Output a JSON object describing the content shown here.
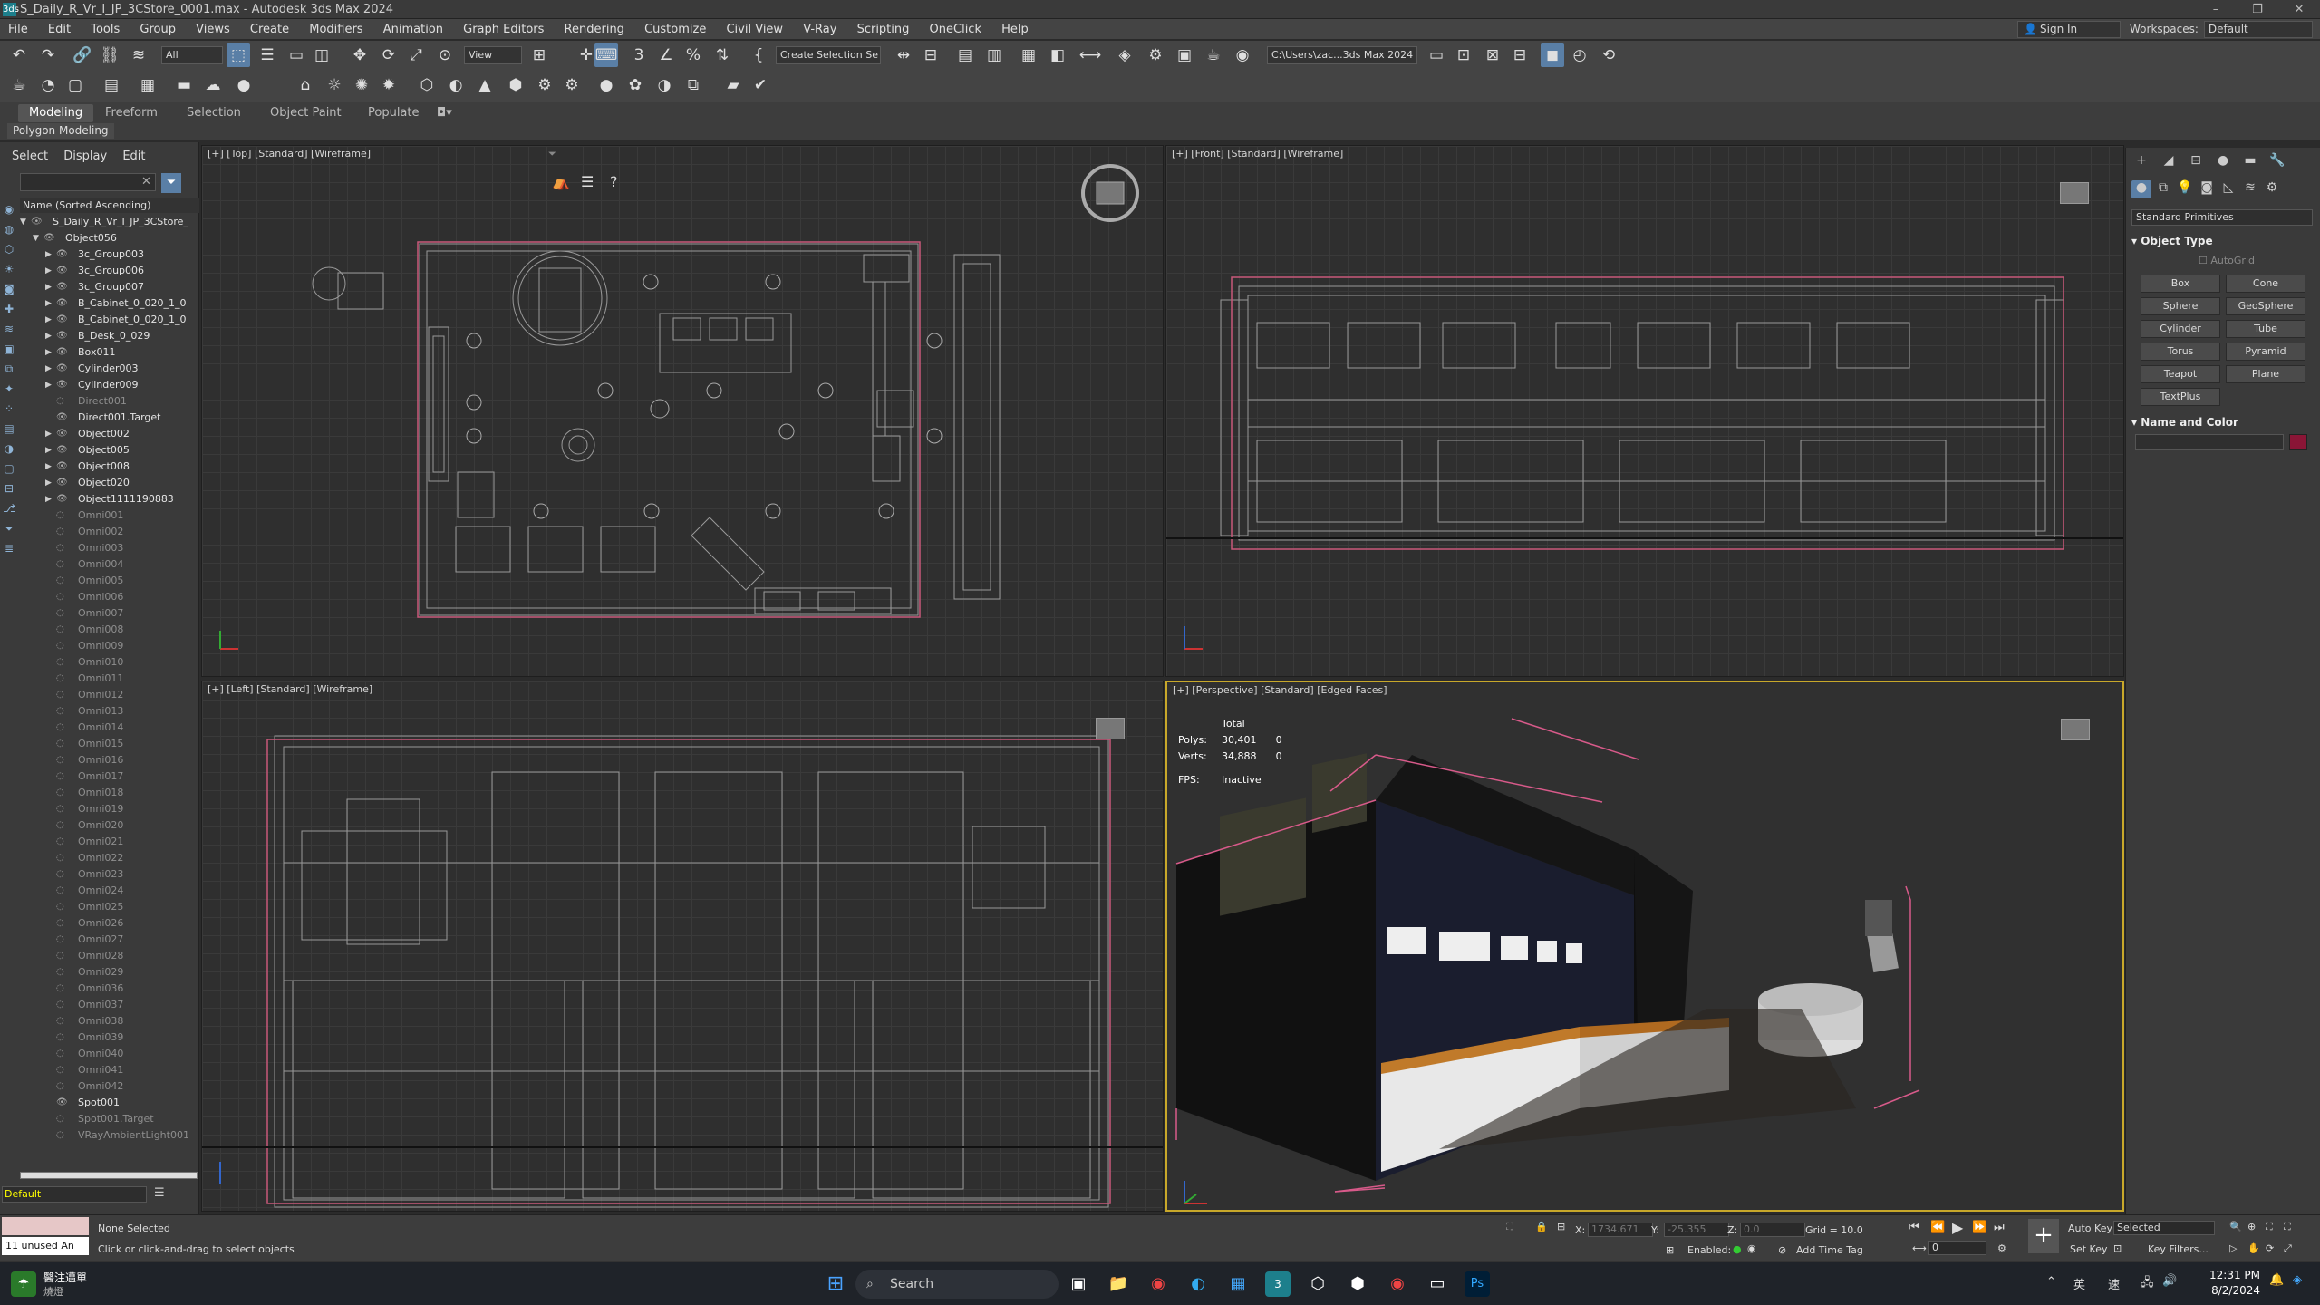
{
  "window": {
    "title": "S_Daily_R_Vr_I_JP_3CStore_0001.max - Autodesk 3ds Max 2024",
    "app_icon": "3ds",
    "controls": [
      "–",
      "❐",
      "✕"
    ]
  },
  "menu": [
    "File",
    "Edit",
    "Tools",
    "Group",
    "Views",
    "Create",
    "Modifiers",
    "Animation",
    "Graph Editors",
    "Rendering",
    "Customize",
    "Civil View",
    "V-Ray",
    "Scripting",
    "OneClick",
    "Help"
  ],
  "signin": "Sign In",
  "workspaces": {
    "label": "Workspaces:",
    "value": "Default"
  },
  "toolbar": {
    "selection_filter": "All",
    "ref_coord": "View",
    "named_selection": "Create Selection Se",
    "project_path": "C:\\Users\\zac...3ds Max 2024"
  },
  "ribbon": {
    "tabs": [
      "Modeling",
      "Freeform",
      "Selection",
      "Object Paint",
      "Populate"
    ],
    "panel": "Polygon Modeling"
  },
  "explorer": {
    "menu": [
      "Select",
      "Display",
      "Edit"
    ],
    "column_header": "Name (Sorted Ascending)",
    "items": [
      {
        "label": "S_Daily_R_Vr_I_JP_3CStore_",
        "level": 0,
        "dim": false,
        "expand": "open"
      },
      {
        "label": "Object056",
        "level": 1,
        "dim": false,
        "expand": "open"
      },
      {
        "label": "3c_Group003",
        "level": 2,
        "dim": false,
        "expand": "closed"
      },
      {
        "label": "3c_Group006",
        "level": 2,
        "dim": false,
        "expand": "closed"
      },
      {
        "label": "3c_Group007",
        "level": 2,
        "dim": false,
        "expand": "closed"
      },
      {
        "label": "B_Cabinet_0_020_1_0",
        "level": 2,
        "dim": false,
        "expand": "closed"
      },
      {
        "label": "B_Cabinet_0_020_1_0",
        "level": 2,
        "dim": false,
        "expand": "closed"
      },
      {
        "label": "B_Desk_0_029",
        "level": 2,
        "dim": false,
        "expand": "closed"
      },
      {
        "label": "Box011",
        "level": 2,
        "dim": false,
        "expand": "closed"
      },
      {
        "label": "Cylinder003",
        "level": 2,
        "dim": false,
        "expand": "closed"
      },
      {
        "label": "Cylinder009",
        "level": 2,
        "dim": false,
        "expand": "closed"
      },
      {
        "label": "Direct001",
        "level": 2,
        "dim": true,
        "expand": ""
      },
      {
        "label": "Direct001.Target",
        "level": 2,
        "dim": false,
        "expand": ""
      },
      {
        "label": "Object002",
        "level": 2,
        "dim": false,
        "expand": "closed"
      },
      {
        "label": "Object005",
        "level": 2,
        "dim": false,
        "expand": "closed"
      },
      {
        "label": "Object008",
        "level": 2,
        "dim": false,
        "expand": "closed"
      },
      {
        "label": "Object020",
        "level": 2,
        "dim": false,
        "expand": "closed"
      },
      {
        "label": "Object1111190883",
        "level": 2,
        "dim": false,
        "expand": "closed"
      },
      {
        "label": "Omni001",
        "level": 2,
        "dim": true,
        "expand": ""
      },
      {
        "label": "Omni002",
        "level": 2,
        "dim": true,
        "expand": ""
      },
      {
        "label": "Omni003",
        "level": 2,
        "dim": true,
        "expand": ""
      },
      {
        "label": "Omni004",
        "level": 2,
        "dim": true,
        "expand": ""
      },
      {
        "label": "Omni005",
        "level": 2,
        "dim": true,
        "expand": ""
      },
      {
        "label": "Omni006",
        "level": 2,
        "dim": true,
        "expand": ""
      },
      {
        "label": "Omni007",
        "level": 2,
        "dim": true,
        "expand": ""
      },
      {
        "label": "Omni008",
        "level": 2,
        "dim": true,
        "expand": ""
      },
      {
        "label": "Omni009",
        "level": 2,
        "dim": true,
        "expand": ""
      },
      {
        "label": "Omni010",
        "level": 2,
        "dim": true,
        "expand": ""
      },
      {
        "label": "Omni011",
        "level": 2,
        "dim": true,
        "expand": ""
      },
      {
        "label": "Omni012",
        "level": 2,
        "dim": true,
        "expand": ""
      },
      {
        "label": "Omni013",
        "level": 2,
        "dim": true,
        "expand": ""
      },
      {
        "label": "Omni014",
        "level": 2,
        "dim": true,
        "expand": ""
      },
      {
        "label": "Omni015",
        "level": 2,
        "dim": true,
        "expand": ""
      },
      {
        "label": "Omni016",
        "level": 2,
        "dim": true,
        "expand": ""
      },
      {
        "label": "Omni017",
        "level": 2,
        "dim": true,
        "expand": ""
      },
      {
        "label": "Omni018",
        "level": 2,
        "dim": true,
        "expand": ""
      },
      {
        "label": "Omni019",
        "level": 2,
        "dim": true,
        "expand": ""
      },
      {
        "label": "Omni020",
        "level": 2,
        "dim": true,
        "expand": ""
      },
      {
        "label": "Omni021",
        "level": 2,
        "dim": true,
        "expand": ""
      },
      {
        "label": "Omni022",
        "level": 2,
        "dim": true,
        "expand": ""
      },
      {
        "label": "Omni023",
        "level": 2,
        "dim": true,
        "expand": ""
      },
      {
        "label": "Omni024",
        "level": 2,
        "dim": true,
        "expand": ""
      },
      {
        "label": "Omni025",
        "level": 2,
        "dim": true,
        "expand": ""
      },
      {
        "label": "Omni026",
        "level": 2,
        "dim": true,
        "expand": ""
      },
      {
        "label": "Omni027",
        "level": 2,
        "dim": true,
        "expand": ""
      },
      {
        "label": "Omni028",
        "level": 2,
        "dim": true,
        "expand": ""
      },
      {
        "label": "Omni029",
        "level": 2,
        "dim": true,
        "expand": ""
      },
      {
        "label": "Omni036",
        "level": 2,
        "dim": true,
        "expand": ""
      },
      {
        "label": "Omni037",
        "level": 2,
        "dim": true,
        "expand": ""
      },
      {
        "label": "Omni038",
        "level": 2,
        "dim": true,
        "expand": ""
      },
      {
        "label": "Omni039",
        "level": 2,
        "dim": true,
        "expand": ""
      },
      {
        "label": "Omni040",
        "level": 2,
        "dim": true,
        "expand": ""
      },
      {
        "label": "Omni041",
        "level": 2,
        "dim": true,
        "expand": ""
      },
      {
        "label": "Omni042",
        "level": 2,
        "dim": true,
        "expand": ""
      },
      {
        "label": "Spot001",
        "level": 2,
        "dim": false,
        "expand": ""
      },
      {
        "label": "Spot001.Target",
        "level": 2,
        "dim": true,
        "expand": ""
      },
      {
        "label": "VRayAmbientLight001",
        "level": 2,
        "dim": true,
        "expand": ""
      }
    ],
    "layer": "Default"
  },
  "viewports": {
    "top": "[+] [Top] [Standard] [Wireframe]",
    "front": "[+] [Front] [Standard] [Wireframe]",
    "left": "[+] [Left] [Standard] [Wireframe]",
    "persp": "[+] [Perspective] [Standard] [Edged Faces]",
    "stats": {
      "header": "Total",
      "polys_label": "Polys:",
      "polys": "30,401",
      "polys_sel": "0",
      "verts_label": "Verts:",
      "verts": "34,888",
      "verts_sel": "0",
      "fps_label": "FPS:",
      "fps": "Inactive"
    }
  },
  "command_panel": {
    "category": "Standard Primitives",
    "object_type": "Object Type",
    "autogrid": "AutoGrid",
    "buttons": [
      "Box",
      "Cone",
      "Sphere",
      "GeoSphere",
      "Cylinder",
      "Tube",
      "Torus",
      "Pyramid",
      "Teapot",
      "Plane",
      "TextPlus"
    ],
    "name_color": "Name and Color",
    "color": "#8a1536"
  },
  "status": {
    "unused": "11 unused An",
    "selection": "None Selected",
    "prompt": "Click or click-and-drag to select objects",
    "x_label": "X:",
    "x": "1734.671",
    "y_label": "Y:",
    "y": "-25.355",
    "z_label": "Z:",
    "z": "0.0",
    "grid": "Grid = 10.0",
    "enabled": "Enabled:",
    "add_time_tag": "Add Time Tag",
    "auto_key": "Auto Key",
    "selected": "Selected",
    "set_key": "Set Key",
    "key_filters": "Key Filters...",
    "frame": "0"
  },
  "taskbar": {
    "weather": "醫注邁單",
    "weather2": "燒燈",
    "search": "Search",
    "ime1": "英",
    "ime2": "速",
    "time": "12:31 PM",
    "date": "8/2/2024"
  }
}
